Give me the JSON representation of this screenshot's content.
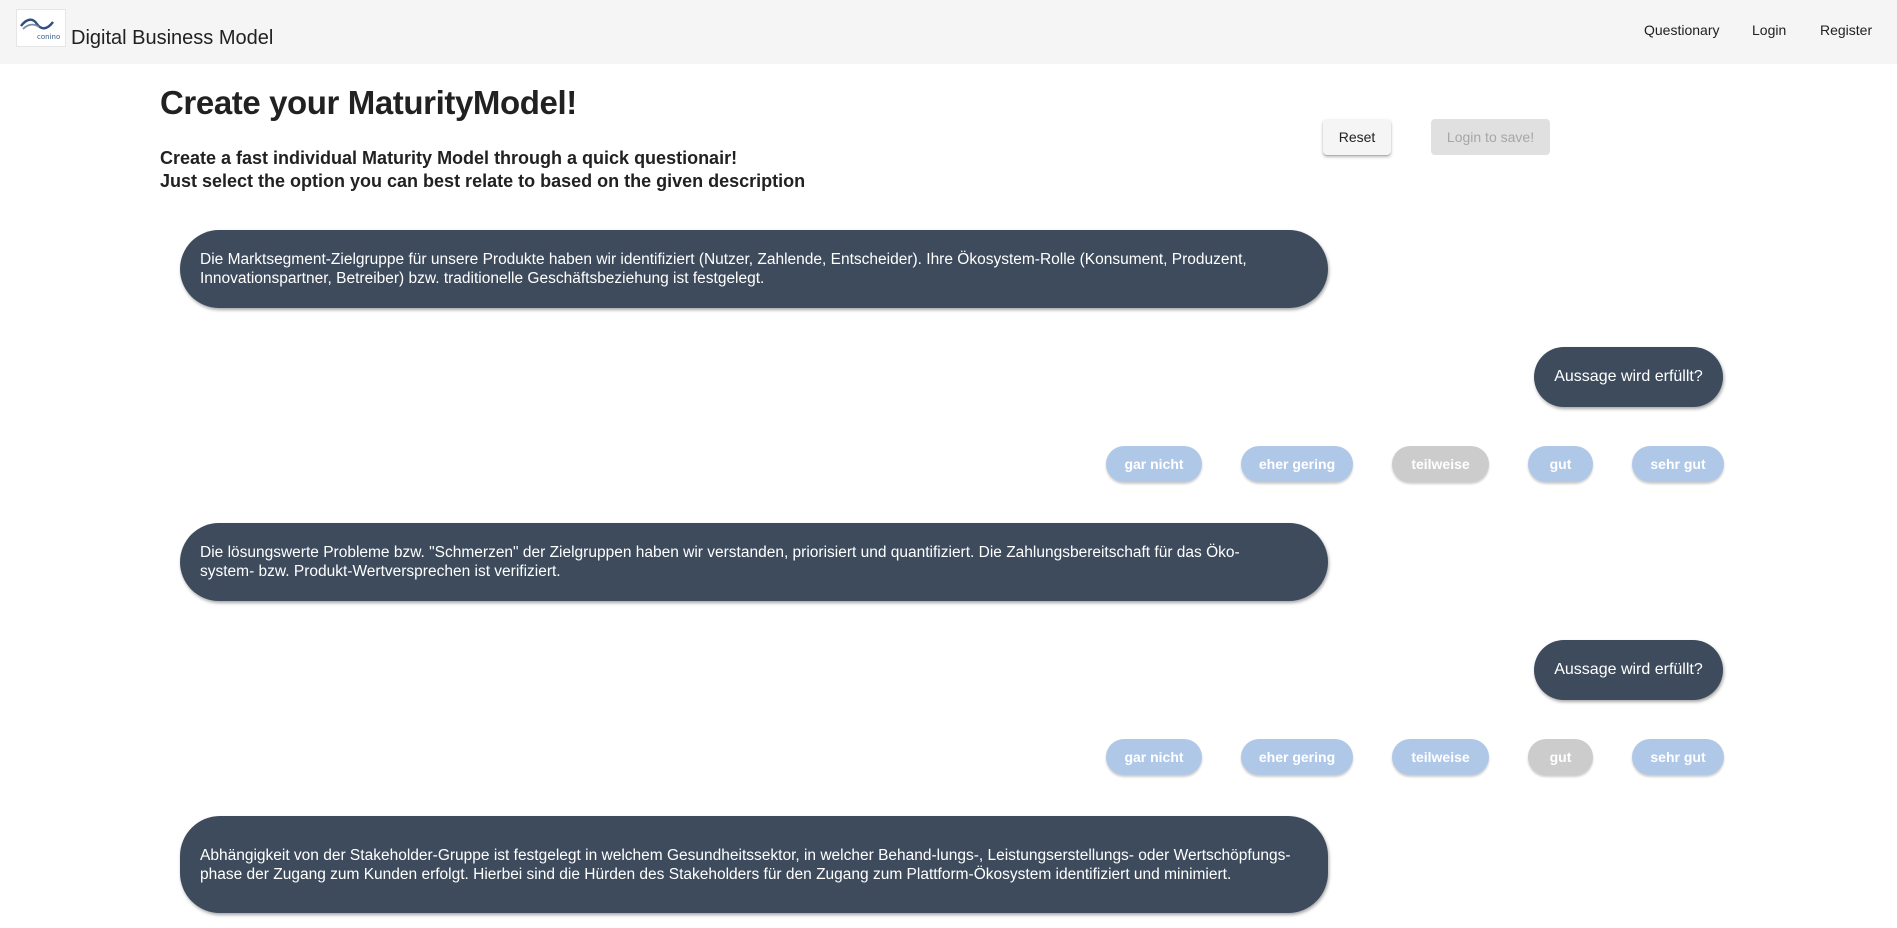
{
  "header": {
    "logo_text": "conino",
    "app_title": "Digital Business Model",
    "nav": [
      "Questionary",
      "Login",
      "Register"
    ]
  },
  "main": {
    "title": "Create your MaturityModel!",
    "subtitle_line1": "Create a fast individual Maturity Model through a quick questionair!",
    "subtitle_line2": "Just select the option you can best relate to based on the given description",
    "reset_label": "Reset",
    "save_label": "Login to save!"
  },
  "questions": [
    {
      "text": "Die Marktsegment-Zielgruppe für unsere Produkte haben wir identifiziert (Nutzer, Zahlende, Entscheider). Ihre Ökosystem-Rolle (Konsument, Produzent, Innovationspartner, Betreiber) bzw. traditionelle Geschäftsbeziehung ist festgelegt.",
      "prompt": "Aussage wird erfüllt?",
      "options": [
        "gar nicht",
        "eher gering",
        "teilweise",
        "gut",
        "sehr gut"
      ],
      "selected": "teilweise"
    },
    {
      "text": "Die lösungswerte Probleme bzw. \"Schmerzen\" der Zielgruppen haben wir verstanden, priorisiert und quantifiziert. Die Zahlungsbereitschaft für das Öko-system- bzw. Produkt-Wertversprechen ist verifiziert.",
      "prompt": "Aussage wird erfüllt?",
      "options": [
        "gar nicht",
        "eher gering",
        "teilweise",
        "gut",
        "sehr gut"
      ],
      "selected": "gut"
    },
    {
      "text": "Abhängigkeit von der Stakeholder-Gruppe ist festgelegt in welchem Gesundheitssektor, in welcher Behand-lungs-, Leistungserstellungs- oder Wertschöpfungs-phase der Zugang zum Kunden erfolgt. Hierbei sind die Hürden des Stakeholders für den Zugang zum Plattform-Ökosystem identifiziert und minimiert."
    }
  ],
  "colors": {
    "app_bar": "#f5f5f5",
    "bubble": "#3d4b5c",
    "option": "#b0c8e8",
    "option_selected": "#cccccc"
  }
}
